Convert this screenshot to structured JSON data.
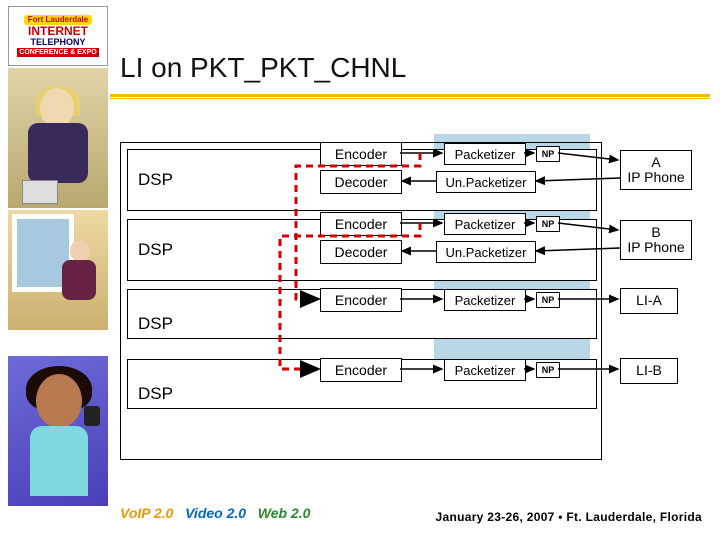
{
  "title": "LI on PKT_PKT_CHNL",
  "dsp": {
    "label": "DSP"
  },
  "blocks": {
    "encoder": "Encoder",
    "decoder": "Decoder",
    "packetizer": "Packetizer",
    "unpacketizer": "Un.Packetizer",
    "np": "NP"
  },
  "outputs": {
    "phoneA_line1": "A",
    "phoneA_line2": "IP Phone",
    "phoneB_line1": "B",
    "phoneB_line2": "IP Phone",
    "liA": "LI-A",
    "liB": "LI-B"
  },
  "footer": {
    "voip": "VoIP 2.0",
    "video": "Video 2.0",
    "web": "Web 2.0",
    "date_loc": "January 23-26, 2007 • Ft. Lauderdale, Florida"
  },
  "logo": {
    "top": "Fort Lauderdale",
    "mid": "INTERNET",
    "bot": "TELEPHONY",
    "tag": "CONFERENCE & EXPO"
  }
}
